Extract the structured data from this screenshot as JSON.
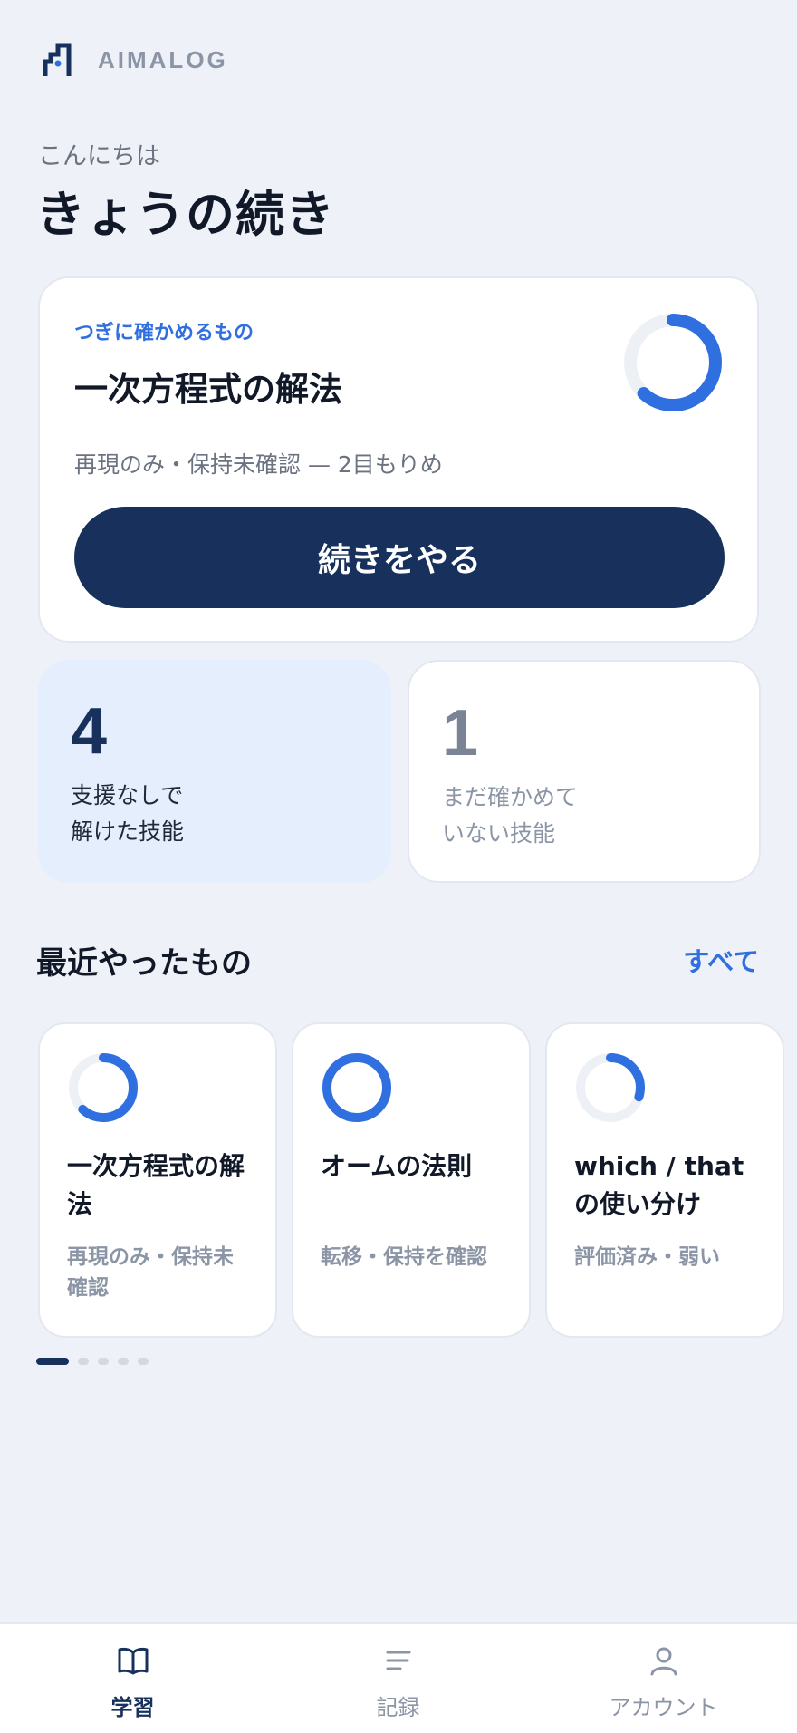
{
  "app": {
    "brand": "AIMALOG"
  },
  "greeting": "こんにちは",
  "headline": "きょうの続き",
  "next_card": {
    "label": "つぎに確かめるもの",
    "title": "一次方程式の解法",
    "status": "再現のみ・保持未確認 — 2目もりめ",
    "progress": 0.62,
    "button_label": "続きをやる"
  },
  "stats": [
    {
      "value": "4",
      "label_line1": "支援なしで",
      "label_line2": "解けた技能"
    },
    {
      "value": "1",
      "label_line1": "まだ確かめて",
      "label_line2": "いない技能"
    }
  ],
  "recent": {
    "title": "最近やったもの",
    "see_all": "すべて",
    "items": [
      {
        "title": "一次方程式の解法",
        "status": "再現のみ・保持未確認",
        "progress": 0.62
      },
      {
        "title": "オームの法則",
        "status": "転移・保持を確認",
        "progress": 1.0
      },
      {
        "title": "which / that の使い分け",
        "status": "評価済み・弱い",
        "progress": 0.3
      }
    ],
    "pages": 5,
    "active_page": 1
  },
  "nav": [
    {
      "label": "学習",
      "icon": "book-icon",
      "active": true
    },
    {
      "label": "記録",
      "icon": "list-icon",
      "active": false
    },
    {
      "label": "アカウント",
      "icon": "user-icon",
      "active": false
    }
  ],
  "colors": {
    "accent": "#2f6fe0",
    "primary": "#17305c",
    "ring_track": "#edf1f6",
    "background": "#eef2f8"
  }
}
